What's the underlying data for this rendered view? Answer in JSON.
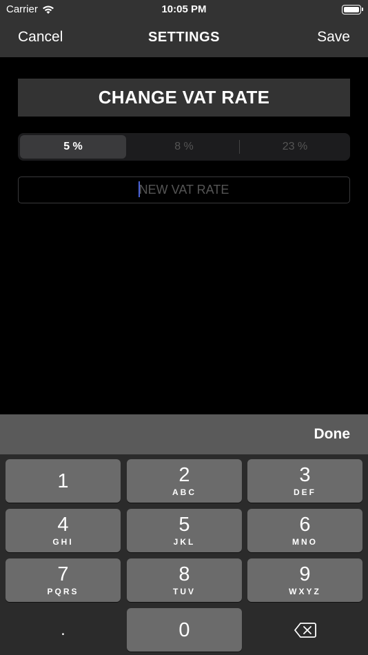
{
  "status_bar": {
    "carrier": "Carrier",
    "time": "10:05 PM"
  },
  "nav": {
    "cancel_label": "Cancel",
    "title": "SETTINGS",
    "save_label": "Save"
  },
  "header": {
    "title": "CHANGE VAT RATE"
  },
  "vat_options": [
    {
      "label": "5 %",
      "selected": true
    },
    {
      "label": "8 %",
      "selected": false
    },
    {
      "label": "23 %",
      "selected": false
    }
  ],
  "vat_input": {
    "value": "",
    "placeholder": "NEW VAT RATE"
  },
  "keyboard": {
    "done_label": "Done",
    "keys": [
      {
        "num": "1",
        "letters": ""
      },
      {
        "num": "2",
        "letters": "ABC"
      },
      {
        "num": "3",
        "letters": "DEF"
      },
      {
        "num": "4",
        "letters": "GHI"
      },
      {
        "num": "5",
        "letters": "JKL"
      },
      {
        "num": "6",
        "letters": "MNO"
      },
      {
        "num": "7",
        "letters": "PQRS"
      },
      {
        "num": "8",
        "letters": "TUV"
      },
      {
        "num": "9",
        "letters": "WXYZ"
      },
      {
        "num": ".",
        "letters": ""
      },
      {
        "num": "0",
        "letters": ""
      }
    ]
  },
  "colors": {
    "nav_background": "#333333",
    "keyboard_background": "#2b2b2b",
    "key_background": "#6b6b6b",
    "caret": "#4a62d8"
  }
}
